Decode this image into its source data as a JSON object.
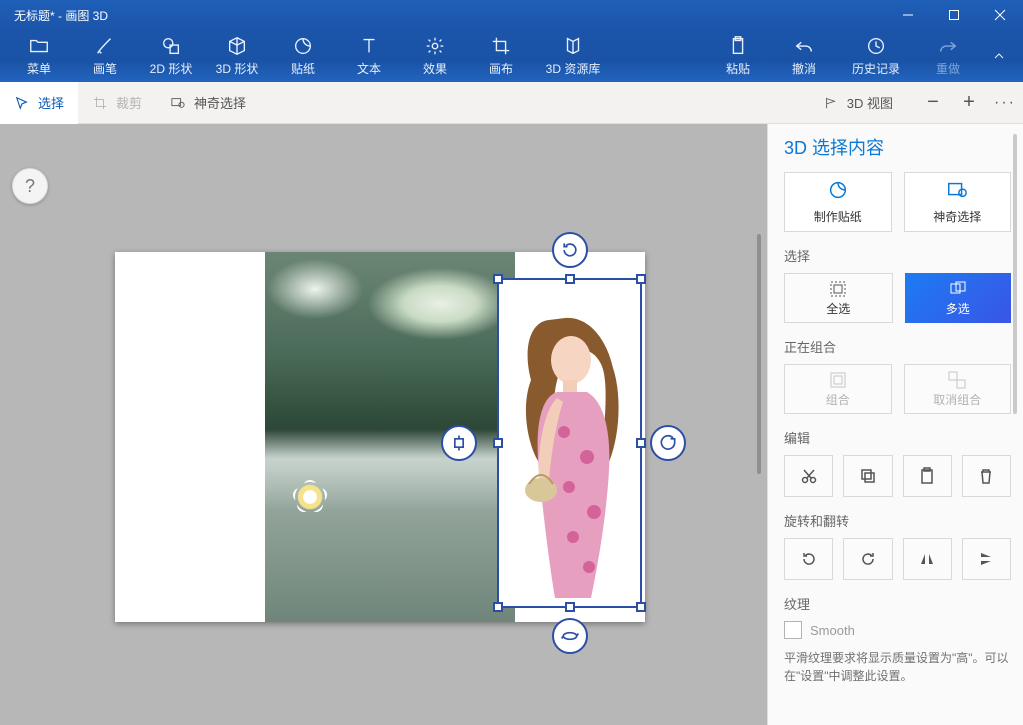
{
  "window": {
    "title": "无标题* - 画图 3D"
  },
  "ribbon": {
    "menu": "菜单",
    "brush": "画笔",
    "shape2d": "2D 形状",
    "shape3d": "3D 形状",
    "sticker": "贴纸",
    "text": "文本",
    "effect": "效果",
    "canvas": "画布",
    "lib3d": "3D 资源库",
    "paste": "粘贴",
    "undo": "撤消",
    "history": "历史记录",
    "redo": "重做"
  },
  "subbar": {
    "select": "选择",
    "crop": "裁剪",
    "magic": "神奇选择",
    "view3d": "3D 视图"
  },
  "panel": {
    "title": "3D 选择内容",
    "cards": {
      "makeSticker": "制作贴纸",
      "magicSelect": "神奇选择"
    },
    "select_section": "选择",
    "selectAll": "全选",
    "multiSelect": "多选",
    "grouping_section": "正在组合",
    "group": "组合",
    "ungroup": "取消组合",
    "edit_section": "编辑",
    "rotate_section": "旋转和翻转",
    "texture_section": "纹理",
    "smooth": "Smooth",
    "note": "平滑纹理要求将显示质量设置为\"高\"。可以在\"设置\"中调整此设置。"
  }
}
